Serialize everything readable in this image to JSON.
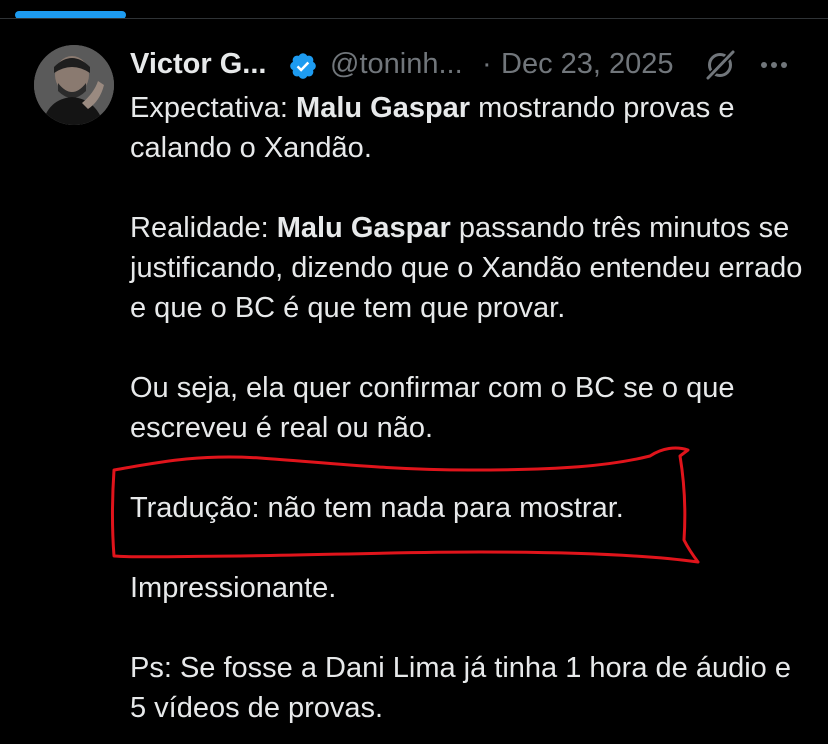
{
  "colors": {
    "background": "#000000",
    "text": "#e7e9ea",
    "muted": "#71767b",
    "accent": "#1d9bf0",
    "verified_badge": "#1d9bf0",
    "highlight": "#e0141b"
  },
  "tweet": {
    "author_name": "Victor G...",
    "verified": true,
    "handle": "@toninh...",
    "separator": "·",
    "date": "Dec 23, 2025",
    "icons": {
      "avatar": "avatar-photo",
      "verified": "verified-badge-icon",
      "grok": "grok-icon",
      "more": "more-options-icon"
    },
    "paragraphs": [
      {
        "segments": [
          {
            "text": "Expectativa: ",
            "bold": false
          },
          {
            "text": "Malu Gaspar",
            "bold": true
          },
          {
            "text": " mostrando provas e calando o Xandão.",
            "bold": false
          }
        ]
      },
      {
        "segments": [
          {
            "text": "Realidade: ",
            "bold": false
          },
          {
            "text": "Malu Gaspar",
            "bold": true
          },
          {
            "text": " passando três minutos se justificando, dizendo que o Xandão entendeu errado e que o BC é que tem que provar.",
            "bold": false
          }
        ]
      },
      {
        "segments": [
          {
            "text": "Ou seja, ela quer confirmar com o BC se o que escreveu é real ou não.",
            "bold": false
          }
        ]
      },
      {
        "segments": [
          {
            "text": "Tradução: não tem nada para mostrar.",
            "bold": false
          }
        ]
      },
      {
        "segments": [
          {
            "text": "Impressionante.",
            "bold": false
          }
        ]
      },
      {
        "segments": [
          {
            "text": "Ps: Se fosse a Dani Lima já tinha 1 hora de áudio e 5 vídeos de provas.",
            "bold": false
          }
        ]
      }
    ]
  }
}
